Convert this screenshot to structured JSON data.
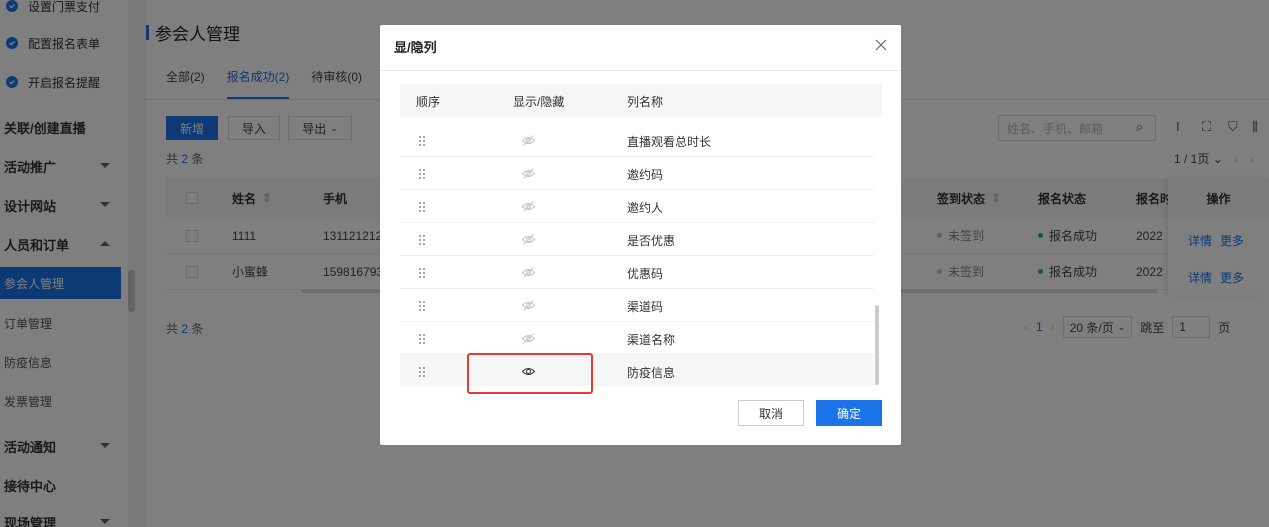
{
  "sidebar": {
    "items": [
      {
        "label": "设置门票支付",
        "type": "check"
      },
      {
        "label": "配置报名表单",
        "type": "check"
      },
      {
        "label": "开启报名提醒",
        "type": "check"
      },
      {
        "label": "关联/创建直播",
        "type": "group"
      },
      {
        "label": "活动推广",
        "type": "group",
        "caret": "down"
      },
      {
        "label": "设计网站",
        "type": "group",
        "caret": "down"
      },
      {
        "label": "人员和订单",
        "type": "group",
        "caret": "up"
      },
      {
        "label": "参会人管理",
        "type": "sub",
        "active": true
      },
      {
        "label": "订单管理",
        "type": "sub"
      },
      {
        "label": "防疫信息",
        "type": "sub"
      },
      {
        "label": "发票管理",
        "type": "sub"
      },
      {
        "label": "活动通知",
        "type": "group",
        "caret": "down"
      },
      {
        "label": "接待中心",
        "type": "group"
      },
      {
        "label": "现场管理",
        "type": "group",
        "caret": "down"
      }
    ]
  },
  "page": {
    "title": "参会人管理",
    "tabs": [
      {
        "label": "全部(2)"
      },
      {
        "label": "报名成功(2)",
        "active": true
      },
      {
        "label": "待审核(0)"
      }
    ],
    "btn_add": "新增",
    "btn_import": "导入",
    "btn_export": "导出",
    "count_prefix": "共",
    "count_value": "2",
    "count_suffix": "条",
    "search_placeholder": "姓名、手机、邮箱",
    "pager_top": "1 / 1页",
    "pager_current": "1",
    "page_size": "20 条/页",
    "jump_label": "跳至",
    "jump_value": "1",
    "jump_suffix": "页"
  },
  "table": {
    "headers": {
      "name": "姓名",
      "phone": "手机",
      "signin": "签到状态",
      "status": "报名状态",
      "regtime": "报名时",
      "ops": "操作"
    },
    "rows": [
      {
        "name": "1111",
        "phone": "131121212",
        "signin": "未签到",
        "status": "报名成功",
        "regtime": "2022",
        "op1": "详情",
        "op2": "更多"
      },
      {
        "name": "小蜜蜂",
        "phone": "159816793",
        "signin": "未签到",
        "status": "报名成功",
        "regtime": "2022",
        "op1": "详情",
        "op2": "更多"
      }
    ]
  },
  "modal": {
    "title": "显/隐列",
    "col_order": "顺序",
    "col_visibility": "显示/隐藏",
    "col_name": "列名称",
    "rows": [
      {
        "name": "直播观看总时长",
        "visible": false
      },
      {
        "name": "邀约码",
        "visible": false
      },
      {
        "name": "邀约人",
        "visible": false
      },
      {
        "name": "是否优惠",
        "visible": false
      },
      {
        "name": "优惠码",
        "visible": false
      },
      {
        "name": "渠道码",
        "visible": false
      },
      {
        "name": "渠道名称",
        "visible": false
      },
      {
        "name": "防疫信息",
        "visible": true
      }
    ],
    "cancel_label": "取消",
    "ok_label": "确定"
  },
  "colors": {
    "accent": "#1a73e8",
    "highlight_box": "#e53935",
    "success_dot": "#19be6b",
    "neutral_dot": "#c0c4cc"
  }
}
